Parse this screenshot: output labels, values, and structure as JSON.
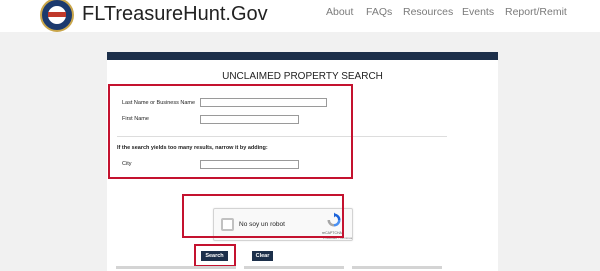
{
  "header": {
    "site_title": "FLTreasureHunt.Gov",
    "nav": {
      "about": "About",
      "faqs": "FAQs",
      "resources": "Resources",
      "events": "Events",
      "report": "Report/Remit"
    }
  },
  "form": {
    "title": "UNCLAIMED PROPERTY SEARCH",
    "last_name_label": "Last Name or Business Name",
    "last_name_value": "",
    "first_name_label": "First Name",
    "first_name_value": "",
    "narrow_hint": "If the search yields too many results, narrow it by adding:",
    "city_label": "City",
    "city_value": ""
  },
  "captcha": {
    "label": "No soy un robot",
    "brand": "reCAPTCHA",
    "terms": "Privacidad - Términos",
    "checked": false
  },
  "buttons": {
    "search": "Search",
    "clear": "Clear"
  },
  "colors": {
    "navy": "#1c2f4a",
    "highlight_red": "#c4122f",
    "page_bg": "#f1f1f1"
  }
}
